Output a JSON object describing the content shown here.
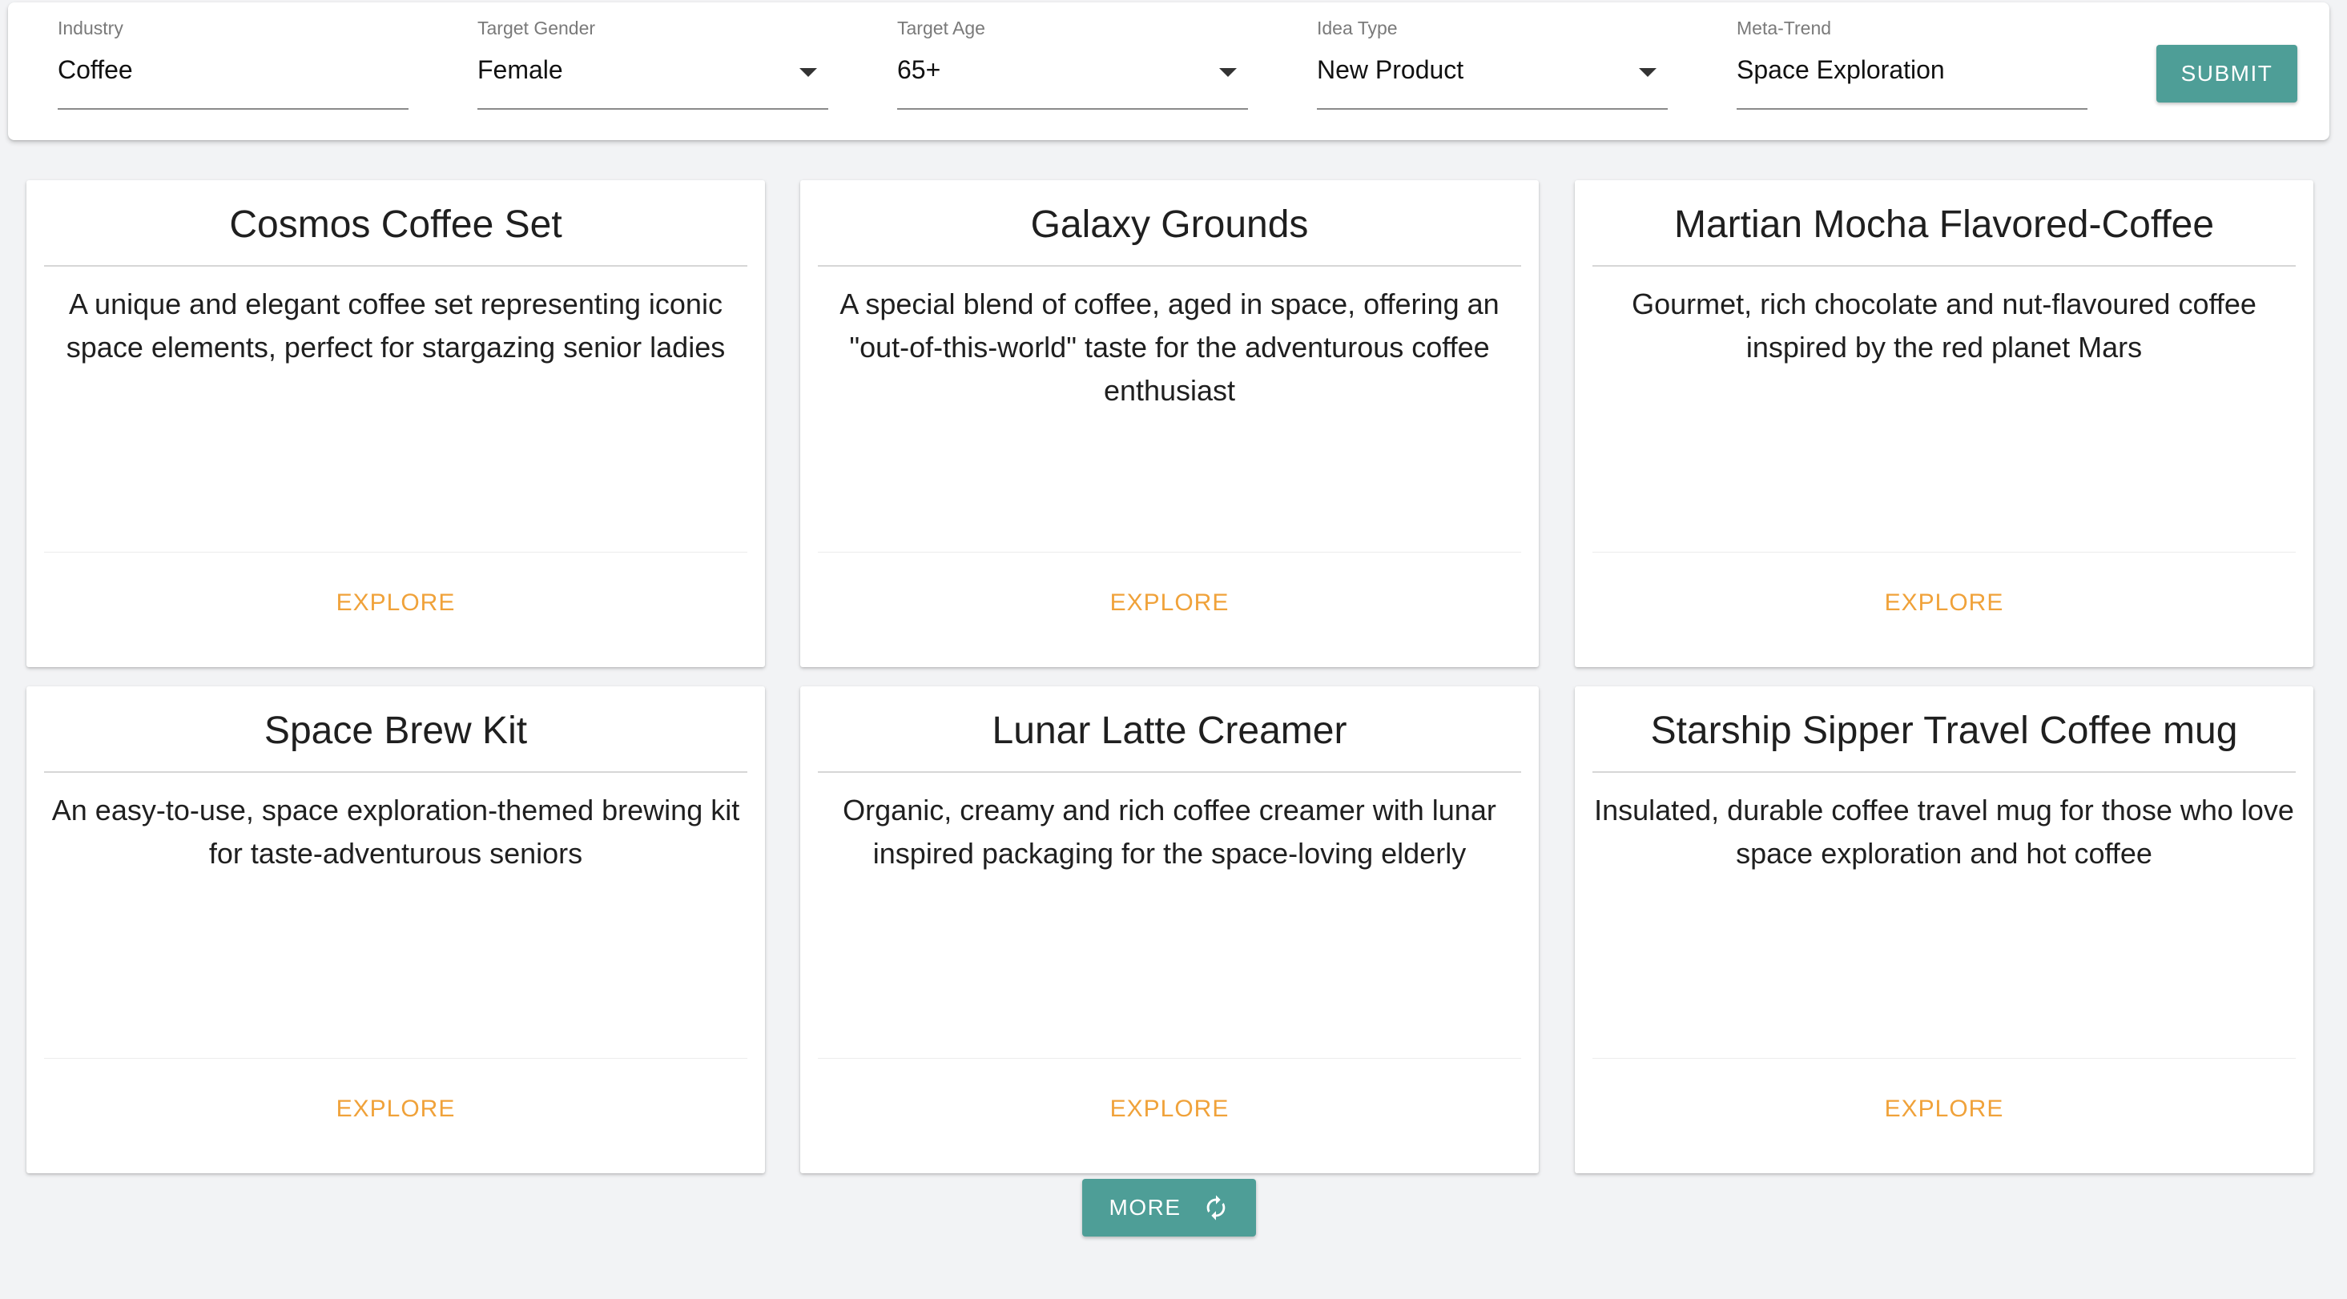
{
  "filters": {
    "industry": {
      "label": "Industry",
      "value": "Coffee"
    },
    "gender": {
      "label": "Target Gender",
      "value": "Female"
    },
    "age": {
      "label": "Target Age",
      "value": "65+"
    },
    "idea_type": {
      "label": "Idea Type",
      "value": "New Product"
    },
    "meta_trend": {
      "label": "Meta-Trend",
      "value": "Space Exploration"
    },
    "submit_label": "SUBMIT"
  },
  "cards": [
    {
      "title": "Cosmos Coffee Set",
      "description": "A unique and elegant coffee set representing iconic space elements, perfect for stargazing senior ladies",
      "action": "EXPLORE"
    },
    {
      "title": "Galaxy Grounds",
      "description": "A special blend of coffee, aged in space, offering an \"out-of-this-world\" taste for the adventurous coffee enthusiast",
      "action": "EXPLORE"
    },
    {
      "title": "Martian Mocha Flavored-Coffee",
      "description": "Gourmet, rich chocolate and nut-flavoured coffee inspired by the red planet Mars",
      "action": "EXPLORE"
    },
    {
      "title": "Space Brew Kit",
      "description": "An easy-to-use, space exploration-themed brewing kit for taste-adventurous seniors",
      "action": "EXPLORE"
    },
    {
      "title": "Lunar Latte Creamer",
      "description": "Organic, creamy and rich coffee creamer with lunar inspired packaging for the space-loving elderly",
      "action": "EXPLORE"
    },
    {
      "title": "Starship Sipper Travel Coffee mug",
      "description": "Insulated, durable coffee travel mug for those who love space exploration and hot coffee",
      "action": "EXPLORE"
    }
  ],
  "more_label": "MORE",
  "colors": {
    "accent_teal": "#4e9e97",
    "explore_orange": "#f0a23a",
    "background": "#f2f3f5"
  },
  "icons": {
    "dropdown": "caret-down-icon",
    "more": "refresh-icon"
  }
}
